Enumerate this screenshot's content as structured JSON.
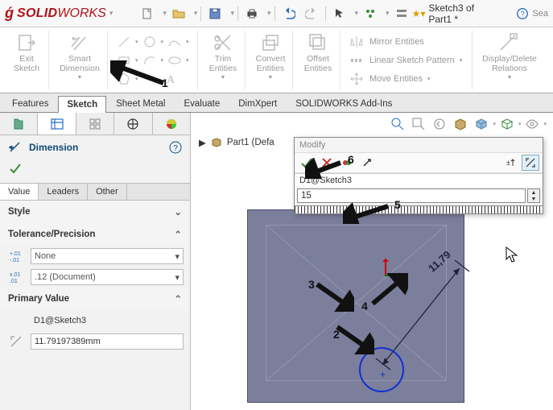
{
  "app": {
    "logo_prefix": "S",
    "logo_solid": "SOLID",
    "logo_works": "WORKS"
  },
  "title_tail": {
    "doc": "Sketch3 of Part1 *",
    "search": "Sea"
  },
  "ribbon": {
    "exit_sketch": "Exit\nSketch",
    "smart_dimension": "Smart\nDimension",
    "trim": "Trim\nEntities",
    "convert": "Convert\nEntities",
    "offset": "Offset\nEntities",
    "mirror": "Mirror Entities",
    "linpat": "Linear Sketch Pattern",
    "move": "Move Entities",
    "display": "Display/Delete\nRelations"
  },
  "tabs": [
    "Features",
    "Sketch",
    "Sheet Metal",
    "Evaluate",
    "DimXpert",
    "SOLIDWORKS Add-Ins"
  ],
  "active_tab": "Sketch",
  "fm_row": {
    "name": "Part1 (Defa"
  },
  "pm": {
    "title": "Dimension",
    "subtabs": [
      "Value",
      "Leaders",
      "Other"
    ],
    "active_subtab": "Value",
    "style_hd": "Style",
    "tolprec_hd": "Tolerance/Precision",
    "tol_sel": "None",
    "prec_sel": ".12 (Document)",
    "primary_hd": "Primary Value",
    "primary_name": "D1@Sketch3",
    "primary_val": "11.79197389mm"
  },
  "dim_txt": "11,79",
  "modify": {
    "title": "Modify",
    "name": "D1@Sketch3",
    "value": "15"
  },
  "annotations": {
    "a1": "1",
    "a2": "2",
    "a3": "3",
    "a4": "4",
    "a5": "5",
    "a6": "6"
  }
}
